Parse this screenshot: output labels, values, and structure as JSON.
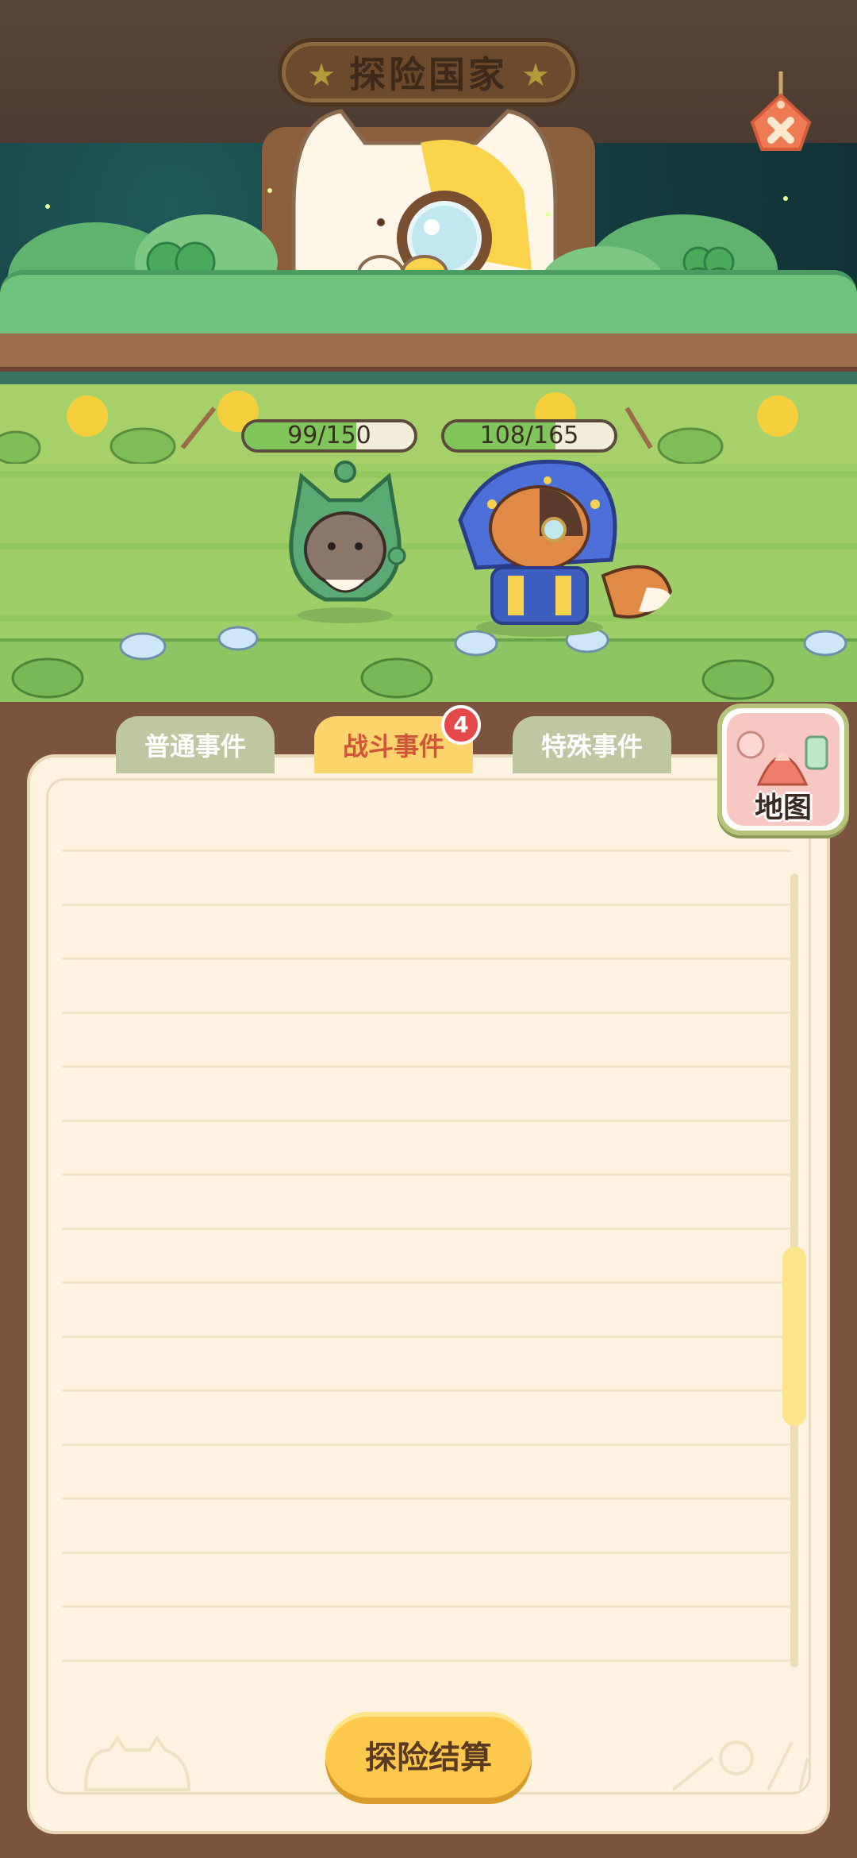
{
  "header": {
    "title": "探险国家",
    "close_icon": "close-x-tag-icon"
  },
  "battle": {
    "player": {
      "hp_text": "99/150",
      "hp_current": 99,
      "hp_max": 150
    },
    "enemy": {
      "hp_text": "108/165",
      "hp_current": 108,
      "hp_max": 165
    }
  },
  "tabs": [
    {
      "label": "普通事件",
      "active": false
    },
    {
      "label": "战斗事件",
      "active": true,
      "badge": "4"
    },
    {
      "label": "特殊事件",
      "active": false
    }
  ],
  "map_button": {
    "label": "地图",
    "icon": "map-icon"
  },
  "settle_button": {
    "label": "探险结算"
  },
  "colors": {
    "panel_bg": "#fdf3e0",
    "active_tab": "#fdd46b",
    "inactive_tab": "#bfc6a2",
    "badge": "#e54848",
    "button": "#fdc84b",
    "hp_fill": "#7fc55a"
  }
}
